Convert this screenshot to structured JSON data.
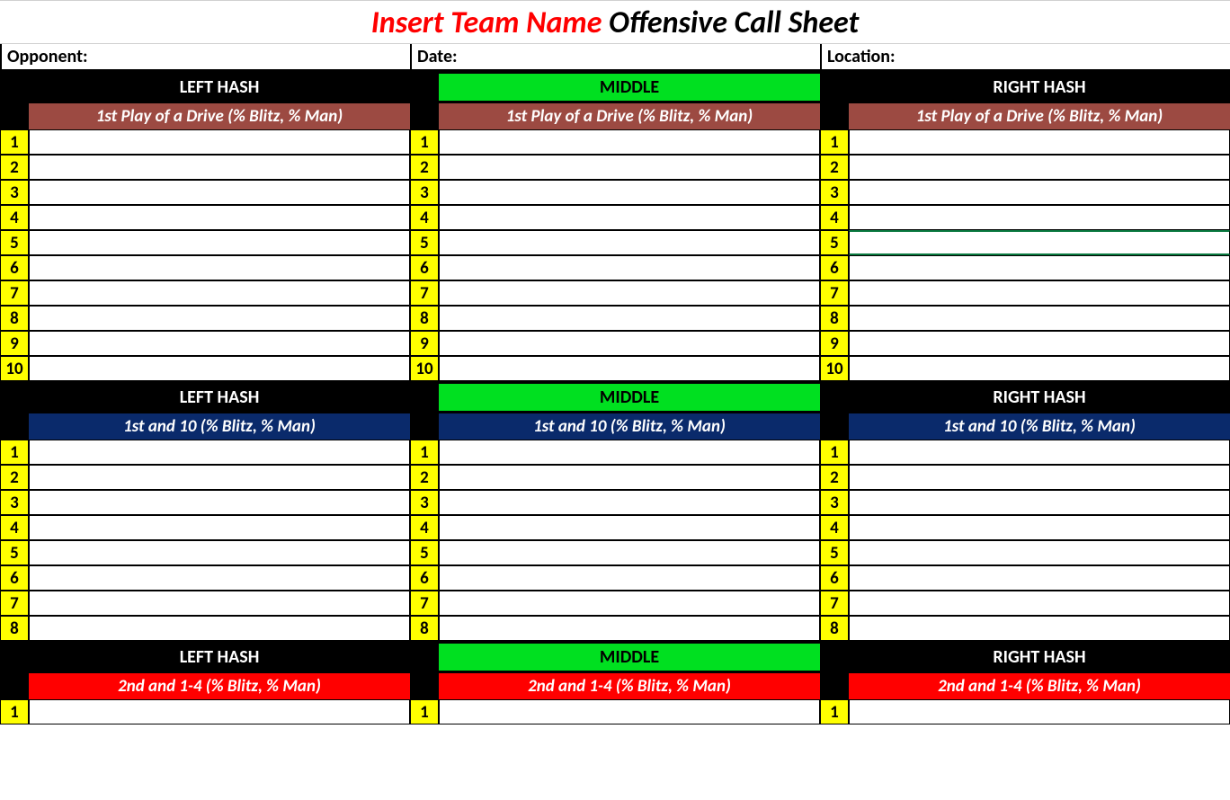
{
  "title": {
    "team_name": "Insert Team Name",
    "suffix": " Offensive Call Sheet"
  },
  "info": {
    "opponent_label": "Opponent:",
    "date_label": "Date:",
    "location_label": "Location:"
  },
  "hash_labels": {
    "left": "LEFT HASH",
    "middle": "MIDDLE",
    "right": "RIGHT HASH"
  },
  "sections": [
    {
      "sub_label": "1st Play of a Drive (% Blitz, % Man)",
      "sub_style": "brick",
      "row_count": 10,
      "selected_row_right": 5
    },
    {
      "sub_label": "1st and 10 (% Blitz, % Man)",
      "sub_style": "navy",
      "row_count": 8
    },
    {
      "sub_label": "2nd and 1-4 (% Blitz, % Man)",
      "sub_style": "red",
      "row_count": 1
    }
  ]
}
